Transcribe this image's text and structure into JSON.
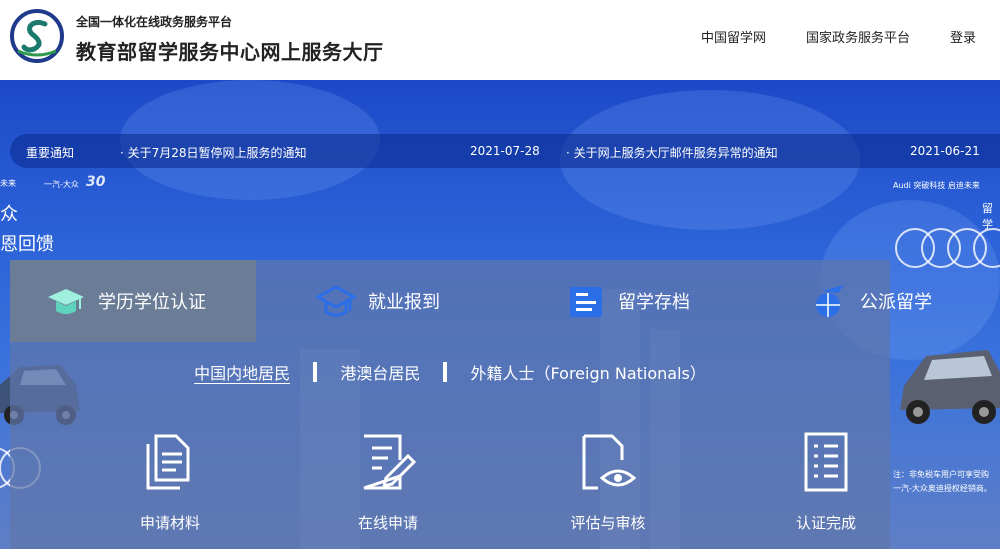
{
  "header": {
    "subtitle": "全国一体化在线政务服务平台",
    "title": "教育部留学服务中心网上服务大厅",
    "nav": [
      "中国留学网",
      "国家政务服务平台",
      "登录"
    ]
  },
  "notice": {
    "label": "重要通知",
    "items": [
      {
        "text": "· 关于7月28日暂停网上服务的通知",
        "date": "2021-07-28"
      },
      {
        "text": "· 关于网上服务大厅邮件服务异常的通知",
        "date": "2021-06-21"
      }
    ]
  },
  "ads": {
    "left_top": "未来",
    "left_2": "一汽-大众",
    "left_3": "30",
    "left_zhong": "众",
    "left_feedback": "恩回馈",
    "right_top": "Audi 突破科技 启迪未来",
    "right_2": "留学",
    "note_line1": "注：非免税车用户可享受购",
    "note_line2": "一汽-大众奥迪授权经销商。"
  },
  "tabs": [
    {
      "label": "学历学位认证",
      "icon": "graduation-cap-icon",
      "active": true
    },
    {
      "label": "就业报到",
      "icon": "mortarboard-icon",
      "active": false
    },
    {
      "label": "留学存档",
      "icon": "archive-folder-icon",
      "active": false
    },
    {
      "label": "公派留学",
      "icon": "airplane-globe-icon",
      "active": false
    }
  ],
  "sub_options": [
    "中国内地居民",
    "港澳台居民",
    "外籍人士（Foreign Nationals）"
  ],
  "steps": [
    {
      "label": "申请材料",
      "icon": "documents-icon"
    },
    {
      "label": "在线申请",
      "icon": "edit-form-icon"
    },
    {
      "label": "评估与审核",
      "icon": "review-eye-icon"
    },
    {
      "label": "认证完成",
      "icon": "checklist-icon"
    }
  ],
  "colors": {
    "banner_top": "#1d49c9",
    "accent_blue": "#2a6ee8",
    "tab_active_bg": "#6b7c97"
  }
}
